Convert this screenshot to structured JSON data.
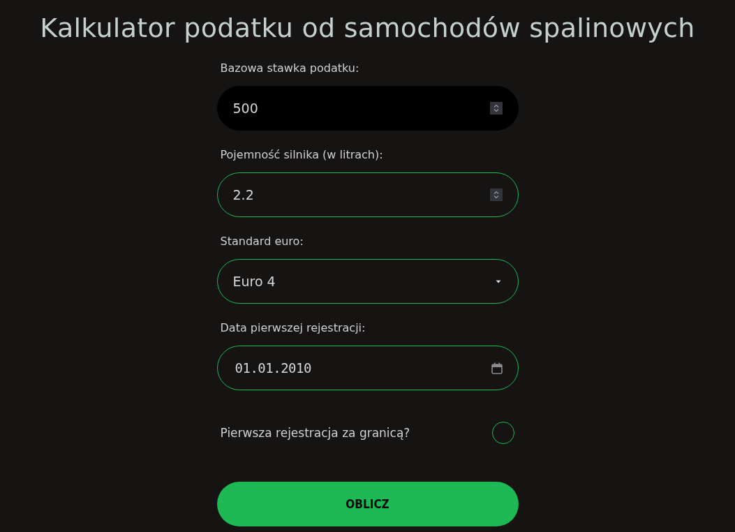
{
  "title": "Kalkulator podatku od samochodów spalinowych",
  "fields": [
    {
      "kind": "number",
      "label": "Bazowa stawka podatku:",
      "value": "500",
      "focused": true
    },
    {
      "kind": "number",
      "label": "Pojemność silnika (w litrach):",
      "value": "2.2",
      "focused": false
    },
    {
      "kind": "select",
      "label": "Standard euro:",
      "value": "Euro 4",
      "focused": false
    },
    {
      "kind": "date",
      "label": "Data pierwszej rejestracji:",
      "value": "01.01.2010",
      "focused": false
    }
  ],
  "checkbox": {
    "label": "Pierwsza rejestracja za granicą?",
    "checked": false
  },
  "button": {
    "label": "OBLICZ"
  }
}
